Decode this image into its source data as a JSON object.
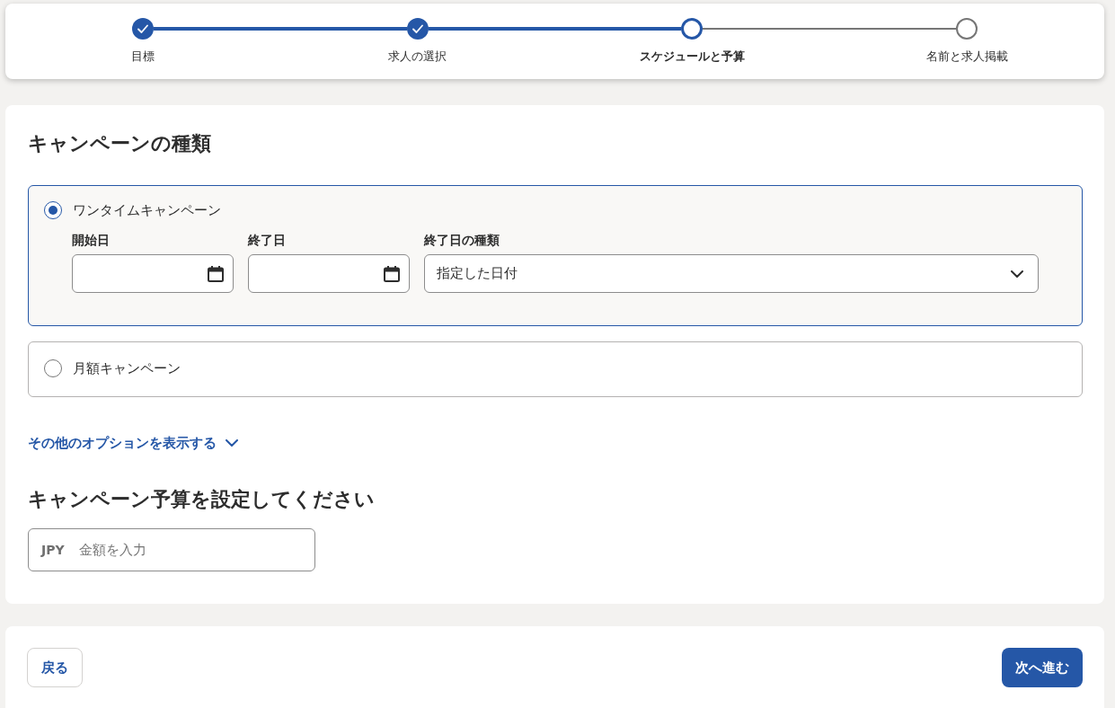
{
  "stepper": {
    "steps": [
      {
        "label": "目標",
        "completed": true,
        "selected": false
      },
      {
        "label": "求人の選択",
        "completed": true,
        "selected": false
      },
      {
        "label": "スケジュールと予算",
        "completed": false,
        "selected": true
      },
      {
        "label": "名前と求人掲載",
        "completed": false,
        "selected": false
      }
    ]
  },
  "campaign_type": {
    "title": "キャンペーンの種類",
    "options": [
      {
        "label": "ワンタイムキャンペーン",
        "selected": true,
        "fields": [
          {
            "kind": "date",
            "label": "開始日"
          },
          {
            "kind": "date",
            "label": "終了日"
          },
          {
            "kind": "select",
            "label": "終了日の種類",
            "value": "指定した日付"
          }
        ]
      },
      {
        "label": "月額キャンペーン",
        "selected": false
      }
    ],
    "more_options": {
      "label": "その他のオプションを表示する",
      "expanded": false
    }
  },
  "budget": {
    "title": "キャンペーン予算を設定してください",
    "currency": "JPY",
    "placeholder": "金額を入力"
  },
  "footer": {
    "back_button": "戻る",
    "next_button": "次へ進む"
  }
}
